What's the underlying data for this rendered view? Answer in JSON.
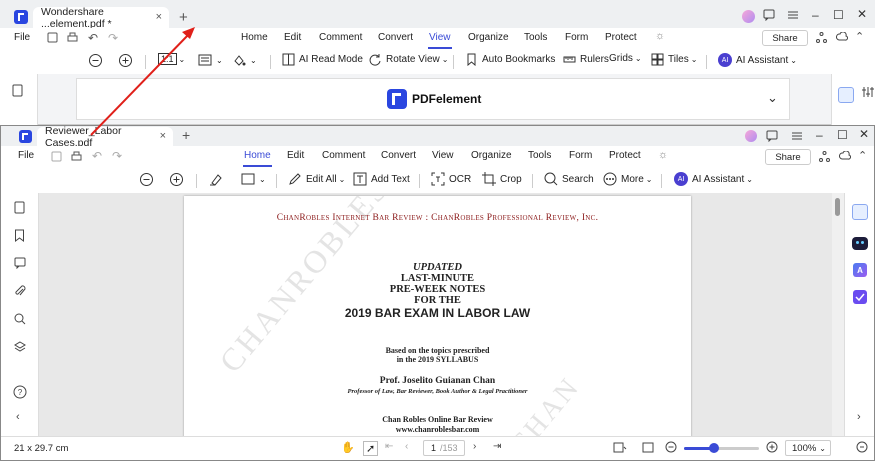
{
  "back_window": {
    "tab_title": "Wondershare ...element.pdf *",
    "file_label": "File",
    "menu": [
      "Home",
      "Edit",
      "Comment",
      "Convert",
      "View",
      "Organize",
      "Tools",
      "Form",
      "Protect"
    ],
    "active_menu": "View",
    "share_label": "Share",
    "toolbar": {
      "zoom_fit": "1:1",
      "ai_read": "AI Read Mode",
      "rotate": "Rotate View",
      "bookmarks": "Auto Bookmarks",
      "rulers": "Rulers",
      "grids": "Grids",
      "tiles": "Tiles",
      "ai_assistant": "AI Assistant"
    },
    "banner_brand": "PDFelement"
  },
  "front_window": {
    "tab_title": "Reviewer_Labor Cases.pdf",
    "file_label": "File",
    "menu": [
      "Home",
      "Edit",
      "Comment",
      "Convert",
      "View",
      "Organize",
      "Tools",
      "Form",
      "Protect"
    ],
    "active_menu": "Home",
    "share_label": "Share",
    "toolbar": {
      "edit_all": "Edit All",
      "add_text": "Add Text",
      "ocr": "OCR",
      "crop": "Crop",
      "search": "Search",
      "more": "More",
      "ai_assistant": "AI Assistant"
    },
    "status": {
      "page_size": "21 x 29.7 cm",
      "page_current": "1",
      "page_total": "/153",
      "zoom": "100%"
    }
  },
  "document": {
    "header": "ChanRobles Internet Bar Review  :  ChanRobles Professional Review, Inc.",
    "title_1": "UPDATED",
    "title_2": "LAST-MINUTE",
    "title_3": "PRE-WEEK NOTES",
    "title_4": "FOR THE",
    "title_5": "2019 BAR EXAM IN LABOR LAW",
    "based_1": "Based on the topics prescribed",
    "based_2": "in the 2019 SYLLABUS",
    "author": "Prof. Joselito Guianan Chan",
    "author_sub": "Professor of Law, Bar Reviewer, Book Author & Legal Practitioner",
    "org": "Chan Robles Online Bar Review",
    "url": "www.chanroblesbar.com",
    "watermark_1": "CHANROBLES BAR",
    "watermark_2": "CHAN"
  },
  "colors": {
    "accent": "#3a4bd6",
    "arrow": "#e0201a",
    "header_red": "#8b1a1a",
    "brand_blue": "#2a46e0"
  }
}
